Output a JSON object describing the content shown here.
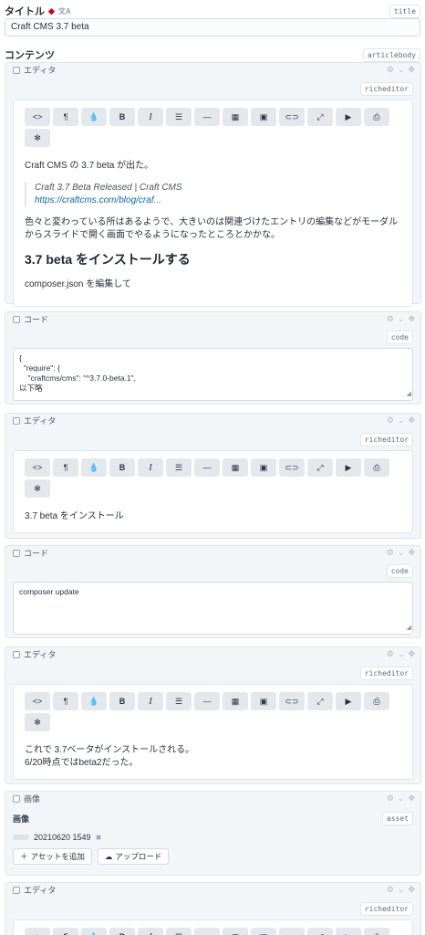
{
  "title_field": {
    "label": "タイトル",
    "required_mark": "◆",
    "translate_icon": "文A",
    "handle": "title",
    "value": "Craft CMS 3.7 beta"
  },
  "content_field": {
    "label": "コンテンツ",
    "handle": "articlebody"
  },
  "block_actions": {
    "settings": "⚙",
    "chevron": "⌄",
    "move": "✥"
  },
  "toolbar": [
    "<>",
    "¶",
    "💧",
    "B",
    "I",
    "☰",
    "—",
    "▦",
    "▣",
    "⊂⊃",
    "⤢",
    "▶",
    "⎙",
    "✻"
  ],
  "blocks": {
    "b1": {
      "type_label": "エディタ",
      "handle": "richeditor",
      "p1": "Craft CMS の 3.7 beta が出た。",
      "quote_title": "Craft 3.7 Beta Released | Craft CMS",
      "quote_link": "https://craftcms.com/blog/craf...",
      "p2": "色々と変わっている所はあるようで、大きいのは関連づけたエントリの編集などがモーダルからスライドで開く画面でやるようになったところとかかな。",
      "h2": "3.7 beta をインストールする",
      "p3": "composer.json を編集して"
    },
    "b2": {
      "type_label": "コード",
      "handle": "code",
      "code": "{\n  \"require\": {\n    \"craftcms/cms\": \"^3.7.0-beta.1\",\n以下略"
    },
    "b3": {
      "type_label": "エディタ",
      "handle": "richeditor",
      "p1": "3.7 beta をインストール"
    },
    "b4": {
      "type_label": "コード",
      "handle": "code",
      "code": "composer update"
    },
    "b5": {
      "type_label": "エディタ",
      "handle": "richeditor",
      "p1": "これで 3.7ベータがインストールされる。",
      "p2": "6/20時点ではbeta2だった。"
    },
    "b6": {
      "type_label": "画像",
      "handle": "asset",
      "field_label": "画像",
      "asset_name": "20210620 1549",
      "remove": "✖",
      "add_label": "アセットを追加",
      "upload_label": "アップロード"
    },
    "b7": {
      "type_label": "エディタ",
      "handle": "richeditor"
    }
  }
}
